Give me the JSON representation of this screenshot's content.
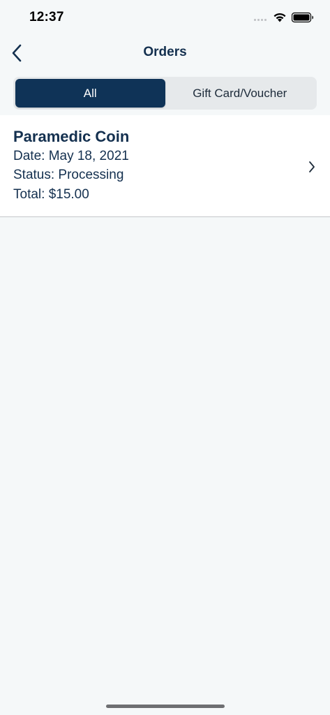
{
  "status_bar": {
    "time": "12:37"
  },
  "nav": {
    "title": "Orders",
    "back_icon": "chevron-left-icon"
  },
  "segments": [
    {
      "label": "All",
      "selected": true
    },
    {
      "label": "Gift Card/Voucher",
      "selected": false
    }
  ],
  "orders": [
    {
      "name": "Paramedic Coin",
      "date": "Date: May 18, 2021",
      "status": "Status: Processing",
      "total": "Total: $15.00"
    }
  ],
  "colors": {
    "primary": "#0f3357",
    "background": "#f5f8f9",
    "text": "#14304f"
  }
}
